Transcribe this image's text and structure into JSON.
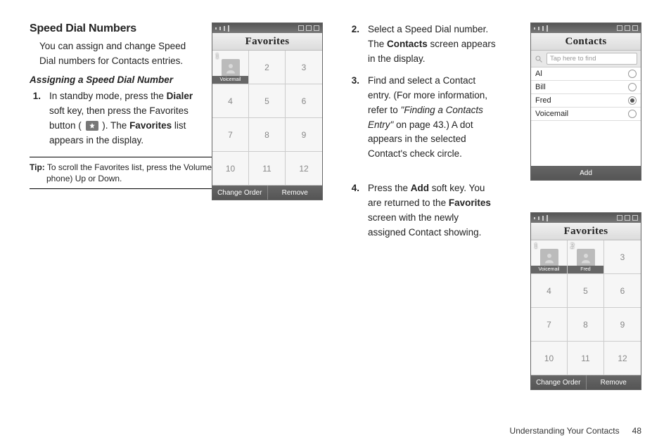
{
  "section": {
    "title": "Speed Dial Numbers",
    "intro": "You can assign and change Speed Dial numbers for Contacts entries.",
    "sub_title": "Assigning a Speed Dial Number"
  },
  "steps": {
    "s1": {
      "num": "1.",
      "t1": "In standby mode, press the ",
      "dialer": "Dialer",
      "t2": " soft key, then press the Favorites button ( ",
      "t3": " ). The ",
      "favorites": "Favorites",
      "t4": " list appears in the display."
    },
    "s2": {
      "num": "2.",
      "t1": "Select a Speed Dial number. The ",
      "contacts": "Contacts",
      "t2": " screen appears in the display."
    },
    "s3": {
      "num": "3.",
      "t1": "Find and select a Contact entry. (For more information, refer to ",
      "ref": "\"Finding a Contacts Entry\"",
      "t2": "  on page 43.) A dot appears in the selected Contact's check circle."
    },
    "s4": {
      "num": "4.",
      "t1": "Press the ",
      "add": "Add",
      "t2": " soft key. You are returned to the ",
      "favorites": "Favorites",
      "t3": " screen with the newly assigned Contact showing."
    }
  },
  "tip": {
    "label": "Tip:",
    "text": " To scroll the Favorites list, press the Volume key (on the left side of the phone) Up or Down."
  },
  "phone_favorites": {
    "title": "Favorites",
    "slots": [
      "1",
      "2",
      "3",
      "4",
      "5",
      "6",
      "7",
      "8",
      "9",
      "10",
      "11",
      "12"
    ],
    "slot1_label": "Voicemail",
    "softkey_left": "Change Order",
    "softkey_right": "Remove"
  },
  "phone_contacts": {
    "title": "Contacts",
    "search_placeholder": "Tap here to find",
    "rows": [
      {
        "name": "Al",
        "selected": false
      },
      {
        "name": "Bill",
        "selected": false
      },
      {
        "name": "Fred",
        "selected": true
      },
      {
        "name": "Voicemail",
        "selected": false
      }
    ],
    "softkey": "Add"
  },
  "phone_favorites2": {
    "title": "Favorites",
    "slot1_label": "Voicemail",
    "slot2_label": "Fred",
    "softkey_left": "Change Order",
    "softkey_right": "Remove"
  },
  "footer": {
    "chapter": "Understanding Your Contacts",
    "page": "48"
  }
}
